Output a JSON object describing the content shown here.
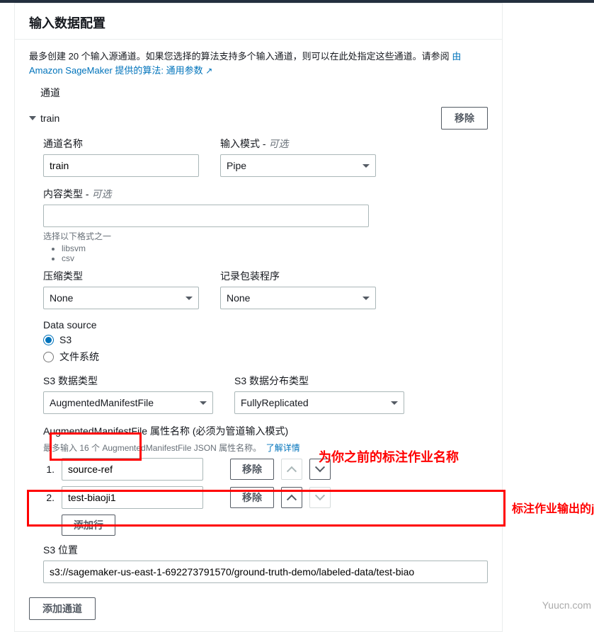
{
  "header": {
    "title": "输入数据配置"
  },
  "intro": {
    "text_a": "最多创建 20 个输入源通道。如果您选择的算法支持多个输入通道，则可以在此处指定这些通道。请参阅",
    "link": "由 Amazon SageMaker 提供的算法: 通用参数",
    "ext_icon": "↗"
  },
  "section_channels_label": "通道",
  "channel": {
    "name": "train",
    "remove_btn": "移除",
    "fields": {
      "channel_name": {
        "label": "通道名称",
        "value": "train"
      },
      "input_mode": {
        "label": "输入模式 -",
        "optional": "可选",
        "value": "Pipe"
      },
      "content_type": {
        "label": "内容类型 -",
        "optional": "可选",
        "value": ""
      },
      "content_type_hint": "选择以下格式之一",
      "content_type_opts": [
        "libsvm",
        "csv"
      ],
      "compress": {
        "label": "压缩类型",
        "value": "None"
      },
      "wrap": {
        "label": "记录包装程序",
        "value": "None"
      },
      "data_source": {
        "label": "Data source",
        "opt_s3": "S3",
        "opt_fs": "文件系统"
      },
      "s3_data_type": {
        "label": "S3 数据类型",
        "value": "AugmentedManifestFile"
      },
      "s3_dist_type": {
        "label": "S3 数据分布类型",
        "value": "FullyReplicated"
      },
      "attr_names": {
        "label": "AugmentedManifestFile 属性名称 (必须为管道输入模式)",
        "hint_a": "最多输入 16 个 AugmentedManifestFile JSON 属性名称。",
        "learn_more": "了解详情",
        "rows": [
          {
            "idx": "1.",
            "value": "source-ref",
            "remove": "移除"
          },
          {
            "idx": "2.",
            "value": "test-biaoji1",
            "remove": "移除"
          }
        ],
        "add_row": "添加行"
      },
      "s3_location": {
        "label": "S3 位置",
        "value": "s3://sagemaker-us-east-1-692273791570/ground-truth-demo/labeled-data/test-biao"
      }
    }
  },
  "add_channel_btn": "添加通道",
  "annotations": {
    "a1": "为你之前的标注作业名称",
    "a2": "标注作业输出的json文件"
  },
  "watermark": "Yuucn.com"
}
